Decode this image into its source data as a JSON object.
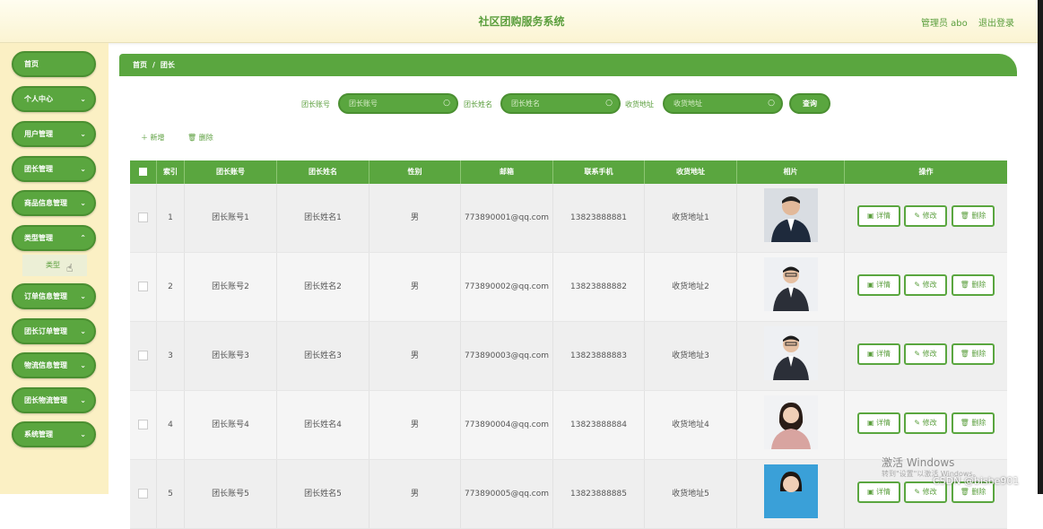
{
  "header": {
    "title": "社区团购服务系统",
    "user": "管理员 abo",
    "logout": "退出登录"
  },
  "sidebar": {
    "items": [
      {
        "label": "首页",
        "chevron": false
      },
      {
        "label": "个人中心",
        "chevron": true
      },
      {
        "label": "用户管理",
        "chevron": true
      },
      {
        "label": "团长管理",
        "chevron": true
      },
      {
        "label": "商品信息管理",
        "chevron": true
      },
      {
        "label": "类型管理",
        "chevron": true
      },
      {
        "label": "订单信息管理",
        "chevron": true
      },
      {
        "label": "团长订单管理",
        "chevron": true
      },
      {
        "label": "物流信息管理",
        "chevron": true
      },
      {
        "label": "团长物流管理",
        "chevron": true
      },
      {
        "label": "系统管理",
        "chevron": true
      }
    ],
    "submenu": {
      "label": "类型"
    }
  },
  "breadcrumb": {
    "home": "首页",
    "sep": "/",
    "current": "团长"
  },
  "search": {
    "fields": [
      {
        "label": "团长账号",
        "placeholder": "团长账号"
      },
      {
        "label": "团长姓名",
        "placeholder": "团长姓名"
      },
      {
        "label": "收货地址",
        "placeholder": "收货地址"
      }
    ],
    "button": "查询"
  },
  "actions": {
    "add": "新增",
    "delete": "删除"
  },
  "table": {
    "headers": [
      "",
      "索引",
      "团长账号",
      "团长姓名",
      "性别",
      "邮箱",
      "联系手机",
      "收货地址",
      "相片",
      "操作"
    ],
    "rows": [
      {
        "index": "1",
        "account": "团长账号1",
        "name": "团长姓名1",
        "gender": "男",
        "email": "773890001@qq.com",
        "phone": "13823888881",
        "address": "收货地址1",
        "photo": "male-suit-photo"
      },
      {
        "index": "2",
        "account": "团长账号2",
        "name": "团长姓名2",
        "gender": "男",
        "email": "773890002@qq.com",
        "phone": "13823888882",
        "address": "收货地址2",
        "photo": "male-glasses-photo"
      },
      {
        "index": "3",
        "account": "团长账号3",
        "name": "团长姓名3",
        "gender": "男",
        "email": "773890003@qq.com",
        "phone": "13823888883",
        "address": "收货地址3",
        "photo": "male-glasses-photo"
      },
      {
        "index": "4",
        "account": "团长账号4",
        "name": "团长姓名4",
        "gender": "男",
        "email": "773890004@qq.com",
        "phone": "13823888884",
        "address": "收货地址4",
        "photo": "female-photo"
      },
      {
        "index": "5",
        "account": "团长账号5",
        "name": "团长姓名5",
        "gender": "男",
        "email": "773890005@qq.com",
        "phone": "13823888885",
        "address": "收货地址5",
        "photo": "female-photo"
      }
    ],
    "op_buttons": {
      "detail": "详情",
      "edit": "修改",
      "delete": "删除"
    }
  },
  "watermark": {
    "line1": "激活 Windows",
    "line2": "转到\"设置\"以激活 Windows。",
    "csdn": "CSDN @bishe901"
  },
  "colors": {
    "accent": "#5aa63f",
    "sidebar_bg": "#fbf0c4",
    "header_title": "#5a9e3c"
  }
}
